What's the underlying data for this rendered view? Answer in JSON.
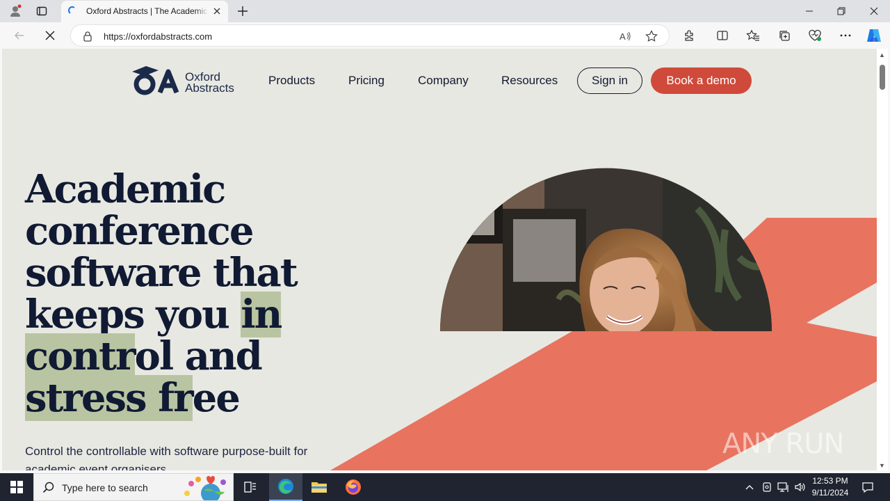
{
  "browser": {
    "tab_title": "Oxford Abstracts | The Academic Conference Software",
    "url": "https://oxfordabstracts.com"
  },
  "site": {
    "logo_line1": "Oxford",
    "logo_line2": "Abstracts",
    "nav": {
      "products": "Products",
      "pricing": "Pricing",
      "company": "Company",
      "resources": "Resources",
      "sign_in": "Sign in",
      "book_demo": "Book a demo"
    },
    "headline": {
      "line1": "Academic",
      "line2": "conference",
      "line3": "software that",
      "line4_plain": "keeps you ",
      "line4_hl": "in",
      "line5_hl": "contr",
      "line5_plain": "ol and",
      "line6_hl": "stress fr",
      "line6_plain": "ee"
    },
    "subtext": "Control the controllable with software purpose-built for academic event organisers",
    "watermark": "ANY RUN"
  },
  "colors": {
    "accent": "#cf4a3a",
    "salmon": "#e8735f",
    "navy": "#101a33",
    "highlight": "#b9c4a2",
    "page_bg": "#e8e8e2"
  },
  "taskbar": {
    "search_placeholder": "Type here to search",
    "time": "12:53 PM",
    "date": "9/11/2024"
  },
  "icons": [
    "profile-icon",
    "tab-actions-icon",
    "edge-favicon-icon",
    "close-icon",
    "plus-icon",
    "minimize-icon",
    "restore-icon",
    "back-icon",
    "stop-icon",
    "lock-icon",
    "read-aloud-icon",
    "favorite-star-icon",
    "extensions-icon",
    "split-screen-icon",
    "favorites-icon",
    "collections-icon",
    "performance-icon",
    "more-icon",
    "copilot-icon",
    "windows-start-icon",
    "search-icon",
    "task-view-icon",
    "edge-icon",
    "file-explorer-icon",
    "firefox-icon",
    "chevron-up-icon",
    "network-icon",
    "volume-icon",
    "notification-icon"
  ]
}
